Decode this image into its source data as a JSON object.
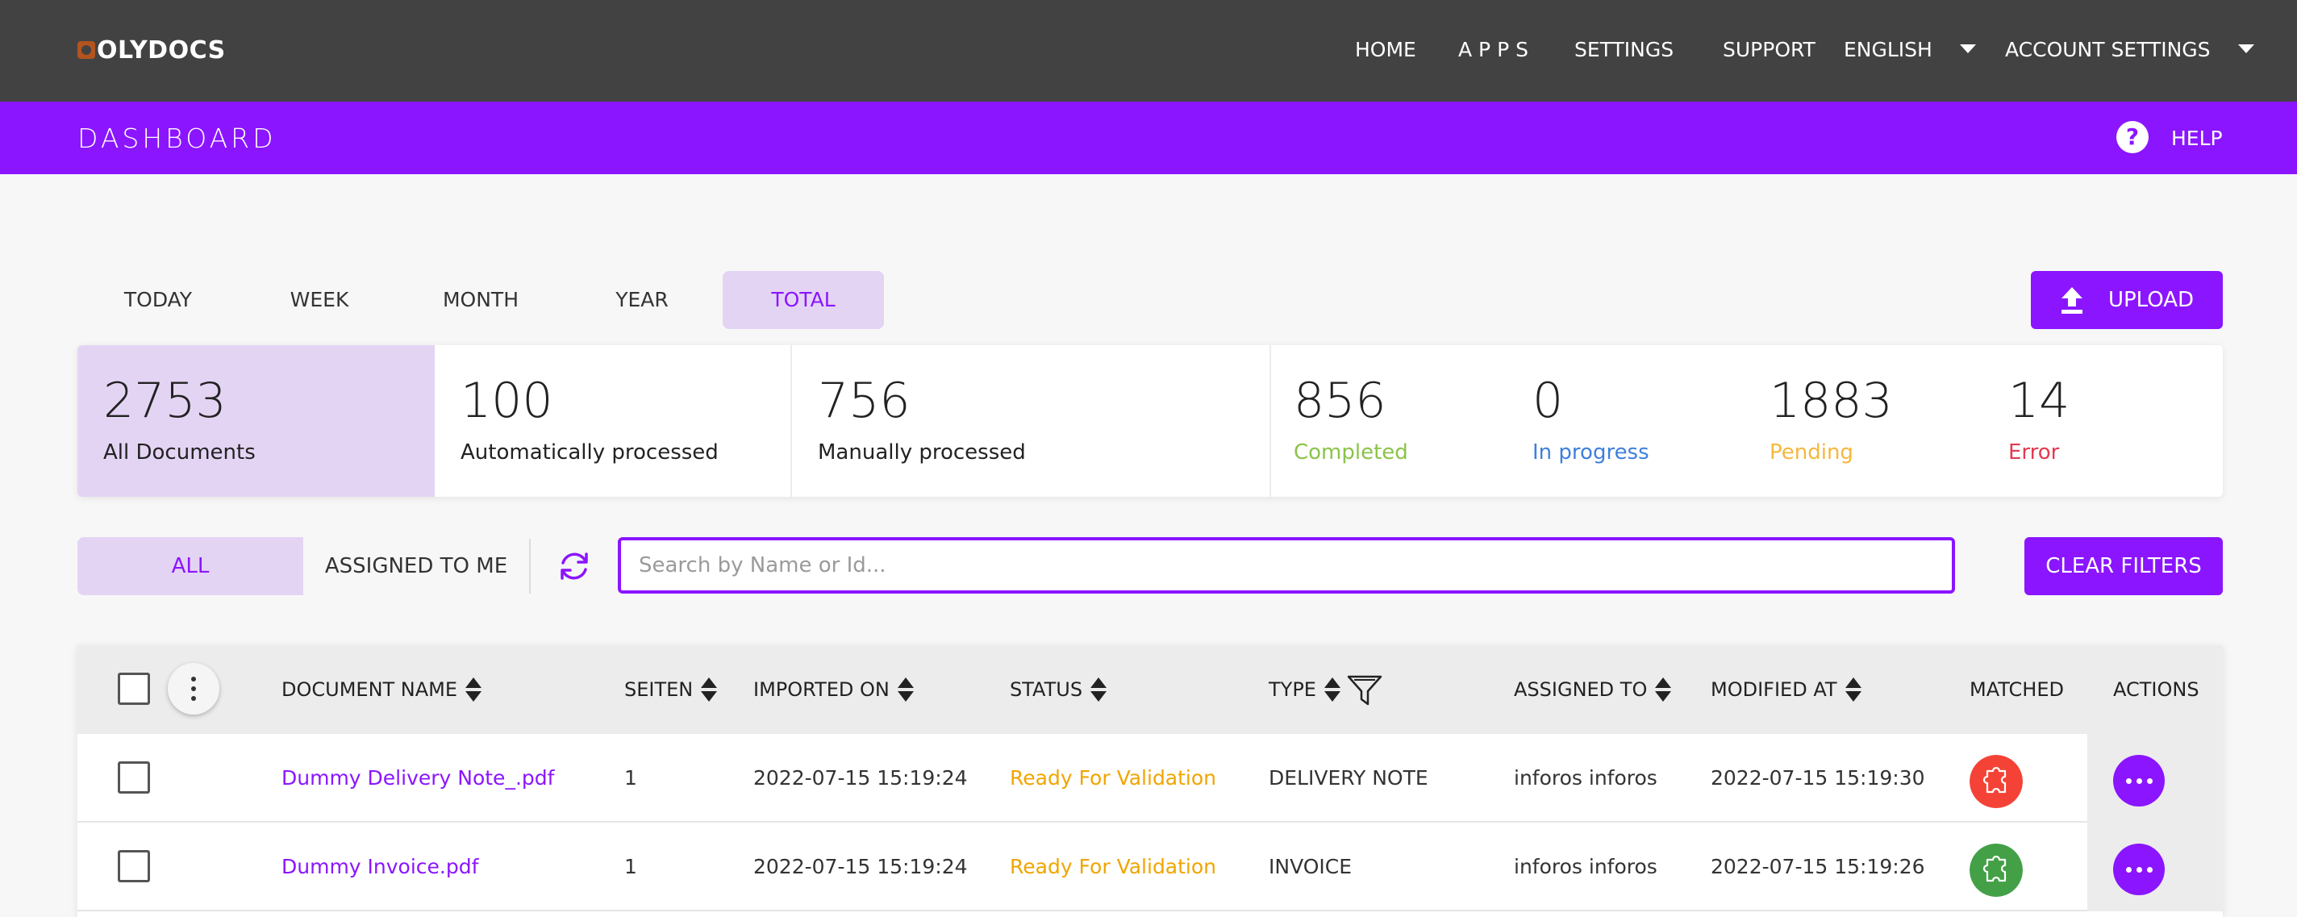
{
  "topbar": {
    "logo_text": "OLYDOCS",
    "nav": {
      "home": "HOME",
      "apps": "A P P S",
      "settings": "SETTINGS",
      "support": "SUPPORT",
      "language": "ENGLISH",
      "account": "ACCOUNT SETTINGS"
    }
  },
  "header": {
    "title": "DASHBOARD",
    "help_icon_glyph": "?",
    "help_label": "HELP"
  },
  "period_tabs": [
    {
      "label": "TODAY",
      "active": false
    },
    {
      "label": "WEEK",
      "active": false
    },
    {
      "label": "MONTH",
      "active": false
    },
    {
      "label": "YEAR",
      "active": false
    },
    {
      "label": "TOTAL",
      "active": true
    }
  ],
  "upload_label": "UPLOAD",
  "stats": {
    "all": {
      "value": "2753",
      "label": "All Documents"
    },
    "auto": {
      "value": "100",
      "label": "Automatically processed"
    },
    "manual": {
      "value": "756",
      "label": "Manually processed"
    },
    "completed": {
      "value": "856",
      "label": "Completed",
      "color": "#8bc34a"
    },
    "in_progress": {
      "value": "0",
      "label": "In progress",
      "color": "#3f7fdc"
    },
    "pending": {
      "value": "1883",
      "label": "Pending",
      "color": "#f5b83d"
    },
    "error": {
      "value": "14",
      "label": "Error",
      "color": "#e53950"
    }
  },
  "filters": {
    "all_label": "ALL",
    "assigned_label": "ASSIGNED TO ME",
    "search_placeholder": "Search by Name or Id...",
    "clear_label": "CLEAR FILTERS"
  },
  "table": {
    "columns": {
      "document_name": "DOCUMENT NAME",
      "pages": "SEITEN",
      "imported_on": "IMPORTED ON",
      "status": "STATUS",
      "type": "TYPE",
      "assigned_to": "ASSIGNED TO",
      "modified_at": "MODIFIED AT",
      "matched": "MATCHED",
      "actions": "ACTIONS"
    },
    "rows": [
      {
        "name": "Dummy Delivery Note_.pdf",
        "pages": "1",
        "imported_on": "2022-07-15 15:19:24",
        "status": "Ready For Validation",
        "type": "DELIVERY NOTE",
        "assigned_to": "inforos inforos",
        "modified_at": "2022-07-15 15:19:30",
        "matched": false,
        "matched_color": "#f44336"
      },
      {
        "name": "Dummy Invoice.pdf",
        "pages": "1",
        "imported_on": "2022-07-15 15:19:24",
        "status": "Ready For Validation",
        "type": "INVOICE",
        "assigned_to": "inforos inforos",
        "modified_at": "2022-07-15 15:19:26",
        "matched": true,
        "matched_color": "#43a047"
      }
    ]
  },
  "colors": {
    "accent": "#8b15ff",
    "accent_light": "#e4d4f4",
    "topbar": "#424242",
    "status_ready": "#f0a500"
  },
  "icons": {
    "logo": "olydocs-logo-icon",
    "help": "help-circle-icon",
    "upload": "upload-icon",
    "refresh": "refresh-icon",
    "more": "more-vertical-icon",
    "filter": "funnel-filter-icon",
    "matched": "puzzle-piece-icon",
    "actions": "more-horizontal-icon"
  }
}
